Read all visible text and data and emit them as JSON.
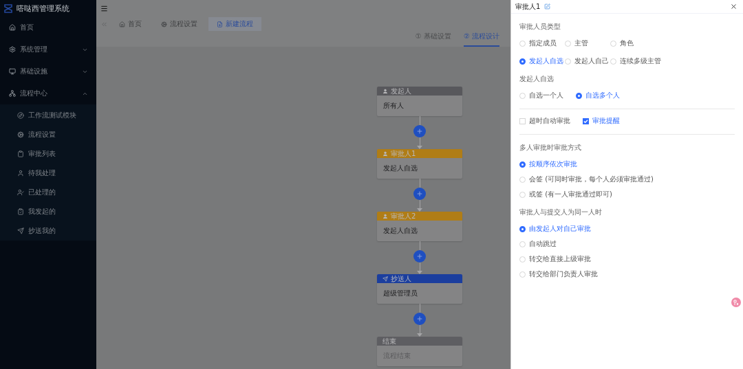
{
  "app_title": "嗒哒西管理系统",
  "sidebar": {
    "items": [
      {
        "label": "首页"
      },
      {
        "label": "系统管理",
        "expanded": false
      },
      {
        "label": "基础设施",
        "expanded": false
      },
      {
        "label": "流程中心",
        "expanded": true,
        "children": [
          {
            "label": "工作流测试模块"
          },
          {
            "label": "流程设置"
          },
          {
            "label": "审批列表"
          },
          {
            "label": "待我处理"
          },
          {
            "label": "已处理的"
          },
          {
            "label": "我发起的"
          },
          {
            "label": "抄送我的"
          }
        ]
      }
    ]
  },
  "tabs": [
    {
      "label": "首页",
      "selected": false
    },
    {
      "label": "流程设置",
      "selected": false
    },
    {
      "label": "新建流程",
      "selected": true
    }
  ],
  "steps": [
    {
      "label": "① 基础设置",
      "selected": false
    },
    {
      "label": "② 流程设计",
      "selected": true
    }
  ],
  "flow": {
    "nodes": [
      {
        "kind": "start",
        "title": "发起人",
        "content": "所有人"
      },
      {
        "kind": "approver",
        "title": "审批人1",
        "content": "发起人自选"
      },
      {
        "kind": "approver",
        "title": "审批人2",
        "content": "发起人自选"
      },
      {
        "kind": "cc",
        "title": "抄送人",
        "content": "超级管理员"
      },
      {
        "kind": "end",
        "title": "结束",
        "content": "流程结束"
      }
    ]
  },
  "drawer": {
    "title": "审批人1",
    "groups": [
      {
        "sections": [
          {
            "kind": "grid",
            "label": "审批人员类型",
            "options": [
              {
                "label": "指定成员",
                "selected": false
              },
              {
                "label": "主管",
                "selected": false
              },
              {
                "label": "角色",
                "selected": false
              },
              {
                "label": "发起人自选",
                "selected": true
              },
              {
                "label": "发起人自己",
                "selected": false
              },
              {
                "label": "连续多级主管",
                "selected": false
              }
            ]
          },
          {
            "kind": "row",
            "label": "发起人自选",
            "options": [
              {
                "label": "自选一个人",
                "selected": false
              },
              {
                "label": "自选多个人",
                "selected": true
              }
            ]
          }
        ]
      },
      {
        "sections": [
          {
            "kind": "checks",
            "options": [
              {
                "label": "超时自动审批",
                "checked": false
              },
              {
                "label": "审批提醒",
                "checked": true
              }
            ]
          }
        ]
      },
      {
        "sections": [
          {
            "kind": "column",
            "label": "多人审批时审批方式",
            "options": [
              {
                "label": "按顺序依次审批",
                "selected": true
              },
              {
                "label": "会签 (可同时审批，每个人必须审批通过)",
                "selected": false
              },
              {
                "label": "或签 (有一人审批通过即可)",
                "selected": false
              }
            ]
          },
          {
            "kind": "column",
            "label": "审批人与提交人为同一人时",
            "options": [
              {
                "label": "由发起人对自己审批",
                "selected": true
              },
              {
                "label": "自动跳过",
                "selected": false
              },
              {
                "label": "转交给直接上级审批",
                "selected": false
              },
              {
                "label": "转交给部门负责人审批",
                "selected": false
              }
            ]
          }
        ]
      }
    ]
  }
}
